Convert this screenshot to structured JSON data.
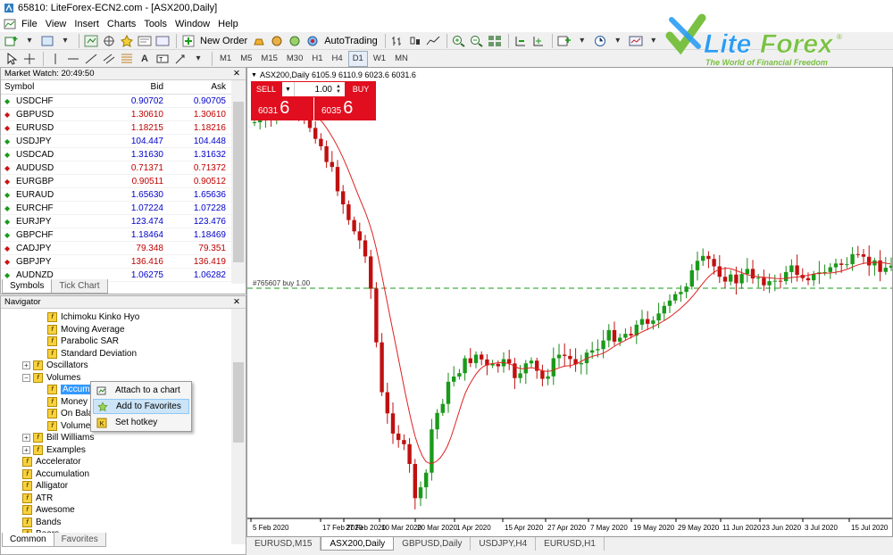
{
  "window": {
    "title": "65810: LiteForex-ECN2.com - [ASX200,Daily]"
  },
  "menu": [
    "File",
    "View",
    "Insert",
    "Charts",
    "Tools",
    "Window",
    "Help"
  ],
  "toolbar": {
    "new_order": "New Order",
    "autotrading": "AutoTrading"
  },
  "timeframes": [
    "M1",
    "M5",
    "M15",
    "M30",
    "H1",
    "H4",
    "D1",
    "W1",
    "MN"
  ],
  "logo": {
    "brand": "LiteForex",
    "tagline": "The World of Financial Freedom",
    "colors": {
      "lite": "#2a9df4",
      "forex": "#7ac143",
      "tagline": "#7ac143"
    }
  },
  "market_watch": {
    "title": "Market Watch: 20:49:50",
    "headers": {
      "symbol": "Symbol",
      "bid": "Bid",
      "ask": "Ask"
    },
    "rows": [
      {
        "symbol": "USDCHF",
        "dir": "up",
        "bid": "0.90702",
        "ask": "0.90705",
        "color": "blue"
      },
      {
        "symbol": "GBPUSD",
        "dir": "down",
        "bid": "1.30610",
        "ask": "1.30610",
        "color": "red"
      },
      {
        "symbol": "EURUSD",
        "dir": "down",
        "bid": "1.18215",
        "ask": "1.18216",
        "color": "red"
      },
      {
        "symbol": "USDJPY",
        "dir": "up",
        "bid": "104.447",
        "ask": "104.448",
        "color": "blue"
      },
      {
        "symbol": "USDCAD",
        "dir": "up",
        "bid": "1.31630",
        "ask": "1.31632",
        "color": "blue"
      },
      {
        "symbol": "AUDUSD",
        "dir": "down",
        "bid": "0.71371",
        "ask": "0.71372",
        "color": "red"
      },
      {
        "symbol": "EURGBP",
        "dir": "down",
        "bid": "0.90511",
        "ask": "0.90512",
        "color": "red"
      },
      {
        "symbol": "EURAUD",
        "dir": "up",
        "bid": "1.65630",
        "ask": "1.65636",
        "color": "blue"
      },
      {
        "symbol": "EURCHF",
        "dir": "up",
        "bid": "1.07224",
        "ask": "1.07228",
        "color": "blue"
      },
      {
        "symbol": "EURJPY",
        "dir": "up",
        "bid": "123.474",
        "ask": "123.476",
        "color": "blue"
      },
      {
        "symbol": "GBPCHF",
        "dir": "up",
        "bid": "1.18464",
        "ask": "1.18469",
        "color": "blue"
      },
      {
        "symbol": "CADJPY",
        "dir": "down",
        "bid": "79.348",
        "ask": "79.351",
        "color": "red"
      },
      {
        "symbol": "GBPJPY",
        "dir": "down",
        "bid": "136.416",
        "ask": "136.419",
        "color": "red"
      },
      {
        "symbol": "AUDNZD",
        "dir": "up",
        "bid": "1.06275",
        "ask": "1.06282",
        "color": "blue"
      }
    ],
    "tabs": [
      "Symbols",
      "Tick Chart"
    ]
  },
  "navigator": {
    "title": "Navigator",
    "items": [
      {
        "label": "Ichimoku Kinko Hyo",
        "level": 3,
        "folder": false
      },
      {
        "label": "Moving Average",
        "level": 3,
        "folder": false
      },
      {
        "label": "Parabolic SAR",
        "level": 3,
        "folder": false
      },
      {
        "label": "Standard Deviation",
        "level": 3,
        "folder": false
      },
      {
        "label": "Oscillators",
        "level": 2,
        "folder": true
      },
      {
        "label": "Volumes",
        "level": 2,
        "folder": true,
        "expanded": true
      },
      {
        "label": "Accum",
        "level": 3,
        "folder": false,
        "selected": true
      },
      {
        "label": "Money",
        "level": 3,
        "folder": false
      },
      {
        "label": "On Bala",
        "level": 3,
        "folder": false
      },
      {
        "label": "Volume",
        "level": 3,
        "folder": false
      },
      {
        "label": "Bill Williams",
        "level": 2,
        "folder": true
      },
      {
        "label": "Examples",
        "level": 2,
        "folder": true
      },
      {
        "label": "Accelerator",
        "level": 2,
        "folder": false
      },
      {
        "label": "Accumulation",
        "level": 2,
        "folder": false
      },
      {
        "label": "Alligator",
        "level": 2,
        "folder": false
      },
      {
        "label": "ATR",
        "level": 2,
        "folder": false
      },
      {
        "label": "Awesome",
        "level": 2,
        "folder": false
      },
      {
        "label": "Bands",
        "level": 2,
        "folder": false
      },
      {
        "label": "Bears",
        "level": 2,
        "folder": false
      }
    ],
    "tabs": [
      "Common",
      "Favorites"
    ]
  },
  "context_menu": [
    "Attach to a chart",
    "Add to Favorites",
    "Set hotkey"
  ],
  "chart": {
    "header": "ASX200,Daily  6105.9 6110.9 6023.6 6031.6",
    "lot": "1.00",
    "sell_label": "SELL",
    "buy_label": "BUY",
    "sell_small": "6031",
    "sell_big": "6",
    "buy_small": "6035",
    "buy_big": "6",
    "order_line": "#765607 buy 1.00",
    "dates": [
      "5 Feb 2020",
      "17 Feb 2020",
      "27 Feb 2020",
      "10 Mar 2020",
      "20 Mar 2020",
      "1 Apr 2020",
      "15 Apr 2020",
      "27 Apr 2020",
      "7 May 2020",
      "19 May 2020",
      "29 May 2020",
      "11 Jun 2020",
      "23 Jun 2020",
      "3 Jul 2020",
      "15 Jul 2020"
    ],
    "tabs": [
      "EURUSD,M15",
      "ASX200,Daily",
      "GBPUSD,Daily",
      "USDJPY,H4",
      "EURUSD,H1"
    ],
    "active_tab": 1
  }
}
